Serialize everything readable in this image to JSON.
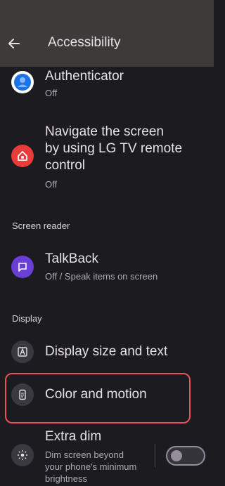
{
  "header": {
    "title": "Accessibility",
    "back_icon": "arrow-left-icon"
  },
  "items": {
    "authenticator": {
      "title": "Authenticator",
      "summary": "Off",
      "icon": "authenticator-icon",
      "icon_color": "#1a73e8"
    },
    "lg_tv": {
      "title_lines": [
        "Navigate the screen",
        "by using LG TV remote",
        "control"
      ],
      "summary": "Off",
      "icon": "home-remote-icon",
      "icon_color": "#ea3b3b"
    },
    "talkback": {
      "title": "TalkBack",
      "summary": "Off / Speak items on screen",
      "icon": "talkback-icon",
      "icon_color": "#6a3fd6"
    },
    "display_size": {
      "title": "Display size and text",
      "icon": "text-size-icon"
    },
    "color_motion": {
      "title": "Color and motion",
      "icon": "phone-icon"
    },
    "extra_dim": {
      "title": "Extra dim",
      "summary_lines": [
        "Dim screen beyond",
        "your phone's minimum",
        "brightness"
      ],
      "icon": "brightness-icon",
      "toggle_state": "off"
    }
  },
  "sections": {
    "screen_reader": "Screen reader",
    "display": "Display"
  },
  "colors": {
    "highlight": "#e8525e",
    "background": "#1c1b1f",
    "header": "#3f3a3a"
  }
}
